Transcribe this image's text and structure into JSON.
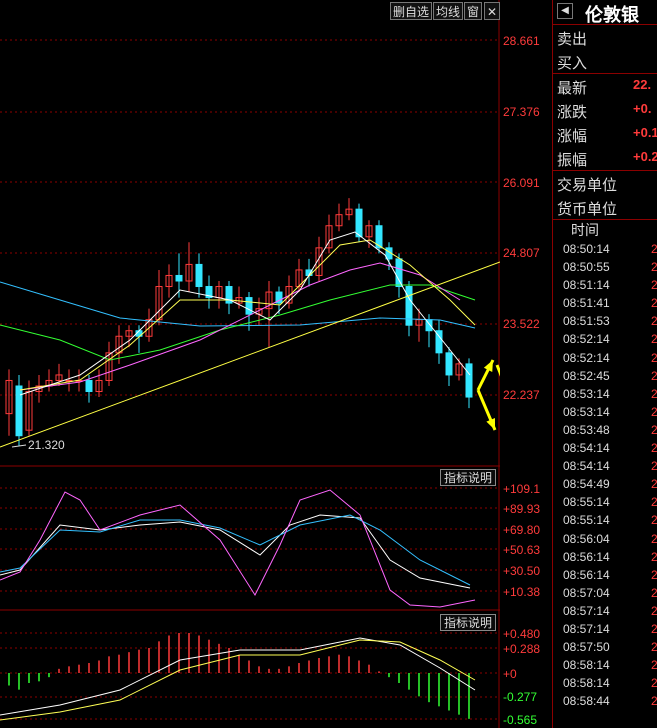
{
  "toolbar": {
    "delete_watch": "删自选",
    "avg_line": "均线",
    "window": "窗",
    "close": "✕"
  },
  "price_axis": [
    "28.661",
    "27.376",
    "26.091",
    "24.807",
    "23.522",
    "22.237"
  ],
  "low_label": "21.320",
  "indicator_button": "指标说明",
  "kdj_axis": [
    "+109.1",
    "+89.93",
    "+69.80",
    "+50.63",
    "+30.50",
    "+10.38"
  ],
  "macd_axis": [
    "+0.480",
    "+0.288",
    "+0",
    "-0.277",
    "-0.565"
  ],
  "stock": {
    "name": "伦敦银",
    "arrow": "◀"
  },
  "quote": {
    "sell": "卖出",
    "buy": "买入",
    "latest_label": "最新",
    "latest_value": "22.",
    "change_label": "涨跌",
    "change_value": "+0.",
    "pct_label": "涨幅",
    "pct_value": "+0.1",
    "amp_label": "振幅",
    "amp_value": "+0.2",
    "unit_label": "交易单位",
    "currency_label": "货币单位"
  },
  "ticks": {
    "header": "时间",
    "times": [
      "08:50:14",
      "08:50:55",
      "08:51:14",
      "08:51:41",
      "08:51:53",
      "08:52:14",
      "08:52:14",
      "08:52:45",
      "08:53:14",
      "08:53:14",
      "08:53:48",
      "08:54:14",
      "08:54:14",
      "08:54:49",
      "08:55:14",
      "08:55:14",
      "08:56:04",
      "08:56:14",
      "08:56:14",
      "08:57:04",
      "08:57:14",
      "08:57:14",
      "08:57:50",
      "08:58:14",
      "08:58:14",
      "08:58:44"
    ],
    "values": [
      "2",
      "2",
      "2",
      "2",
      "2",
      "2",
      "2",
      "2",
      "2",
      "2",
      "2",
      "2",
      "2",
      "2",
      "2",
      "2",
      "2",
      "2",
      "2",
      "2",
      "2",
      "2",
      "2",
      "2",
      "2",
      "2"
    ]
  },
  "colors": {
    "up": "#ff3b3b",
    "down": "#33e6ff",
    "ma5": "#ffffff",
    "ma10": "#ffff55",
    "ma20": "#ff66ff",
    "ma30": "#33ff33",
    "ma60": "#33c0ff",
    "trend": "#ffff44",
    "arrow": "#ffff00",
    "grid": "#8b0000"
  }
}
